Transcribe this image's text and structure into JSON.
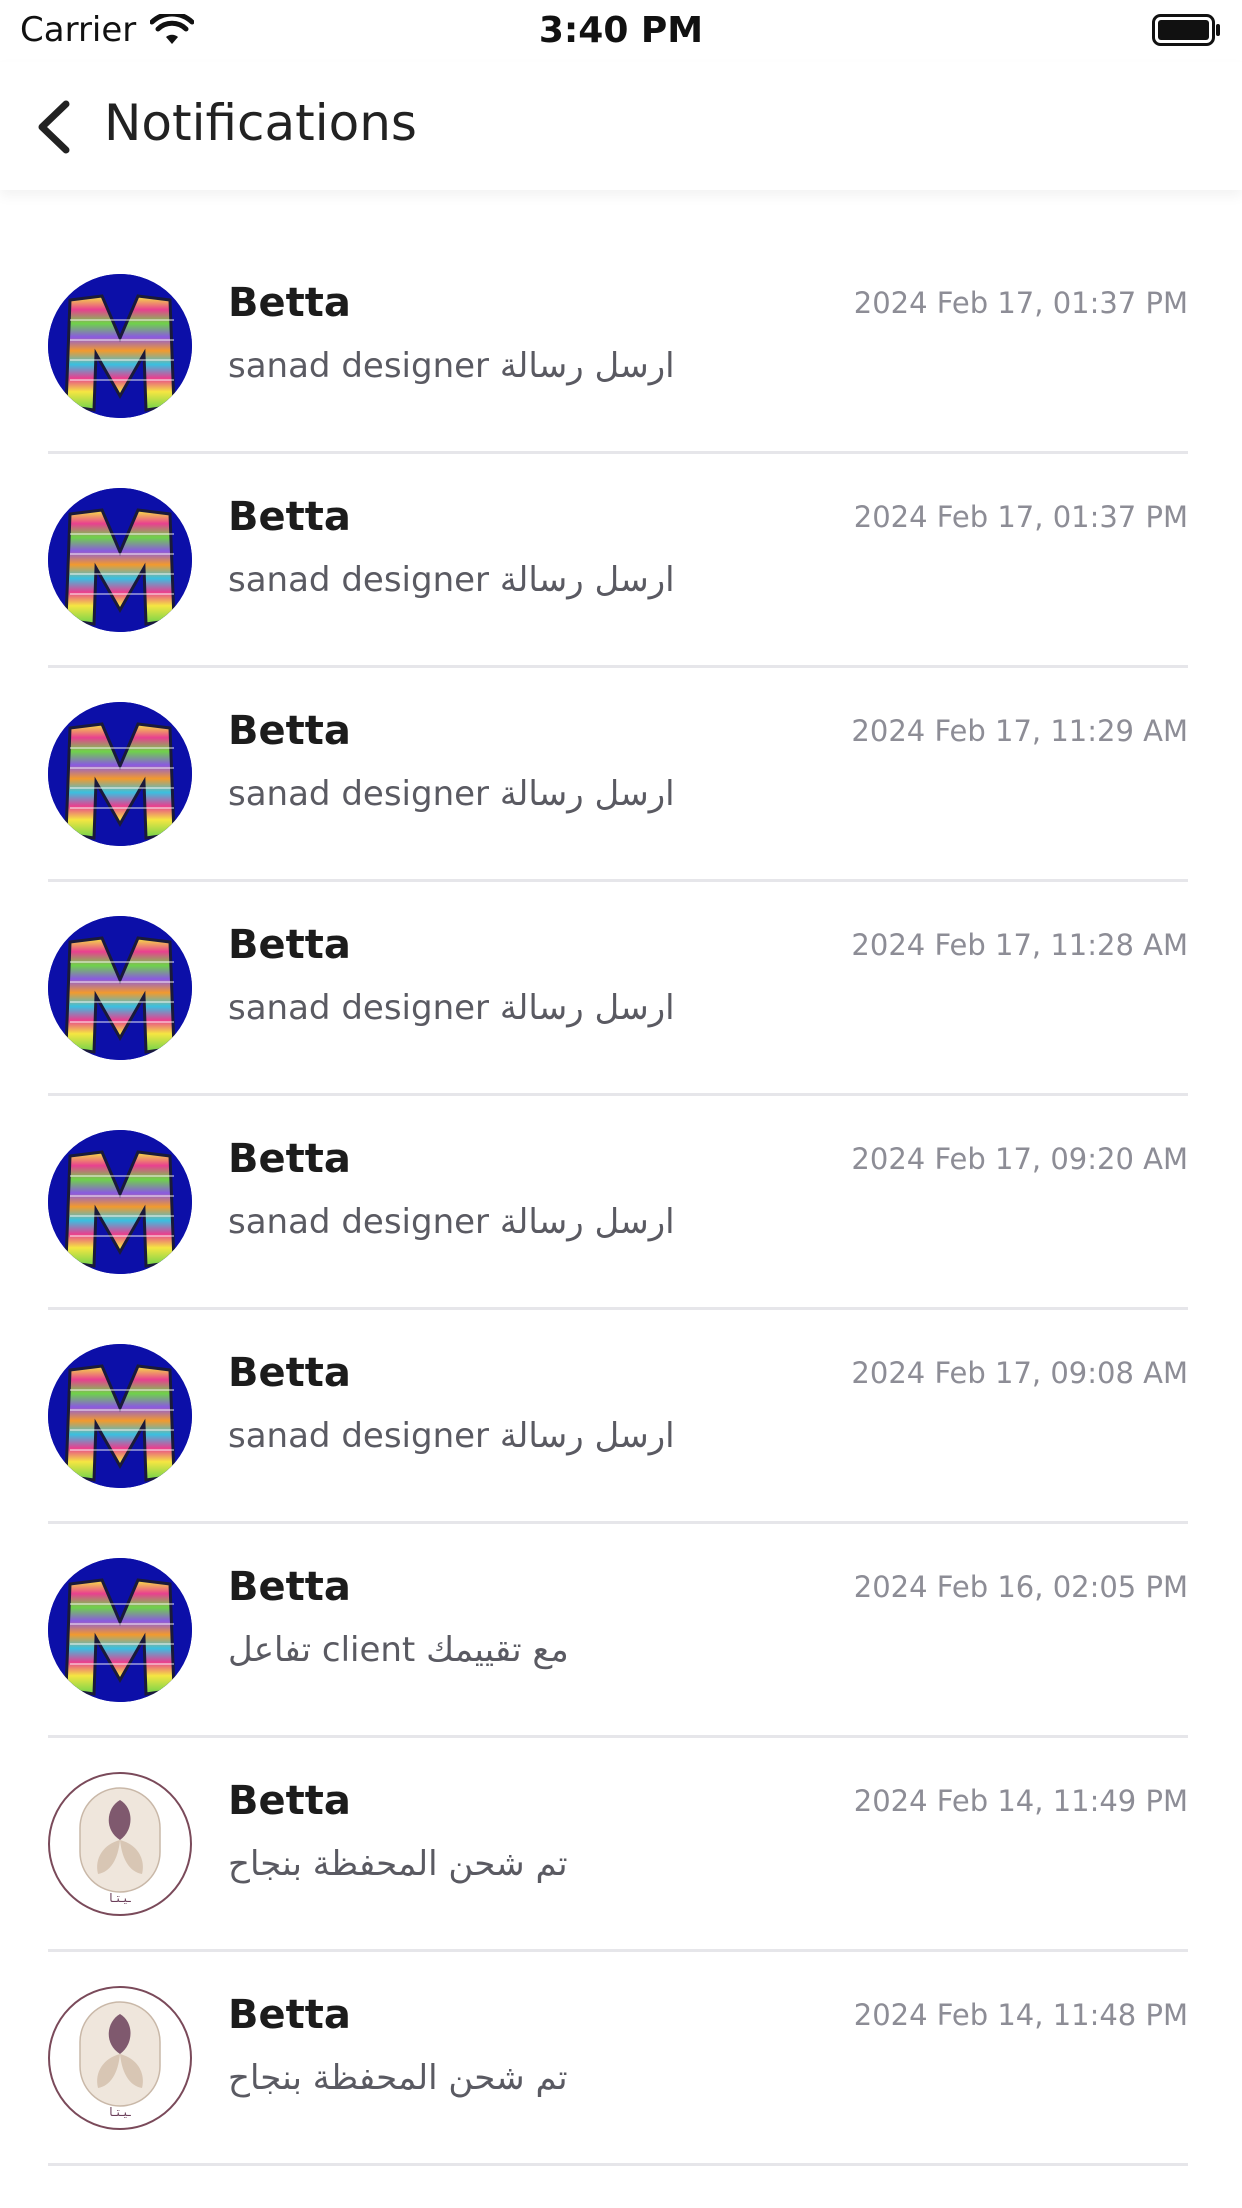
{
  "status_bar": {
    "carrier": "Carrier",
    "time": "3:40 PM",
    "wifi_icon": "wifi-icon",
    "battery_icon": "battery-icon"
  },
  "nav": {
    "title": "Notifications",
    "back_icon": "chevron-left-icon"
  },
  "notifications": [
    {
      "name": "Betta",
      "time": "2024 Feb 17, 01:37 PM",
      "message": "sanad designer ارسل رسالة",
      "avatar": "m"
    },
    {
      "name": "Betta",
      "time": "2024 Feb 17, 01:37 PM",
      "message": "sanad designer ارسل رسالة",
      "avatar": "m"
    },
    {
      "name": "Betta",
      "time": "2024 Feb 17, 11:29 AM",
      "message": "sanad designer ارسل رسالة",
      "avatar": "m"
    },
    {
      "name": "Betta",
      "time": "2024 Feb 17, 11:28 AM",
      "message": "sanad designer ارسل رسالة",
      "avatar": "m"
    },
    {
      "name": "Betta",
      "time": "2024 Feb 17, 09:20 AM",
      "message": "sanad designer ارسل رسالة",
      "avatar": "m"
    },
    {
      "name": "Betta",
      "time": "2024 Feb 17, 09:08 AM",
      "message": "sanad designer ارسل رسالة",
      "avatar": "m"
    },
    {
      "name": "Betta",
      "time": "2024 Feb 16, 02:05 PM",
      "message": "تفاعل client مع تقييمك",
      "avatar": "m"
    },
    {
      "name": "Betta",
      "time": "2024 Feb 14, 11:49 PM",
      "message": "تم شحن المحفظة بنجاح",
      "avatar": "logo"
    },
    {
      "name": "Betta",
      "time": "2024 Feb 14, 11:48 PM",
      "message": "تم شحن المحفظة بنجاح",
      "avatar": "logo"
    }
  ],
  "colors": {
    "avatar_m_bg": "#0c0fa8",
    "logo_border": "#7a4a5a",
    "divider": "#e6e6ea",
    "time_text": "#8d8d96"
  }
}
